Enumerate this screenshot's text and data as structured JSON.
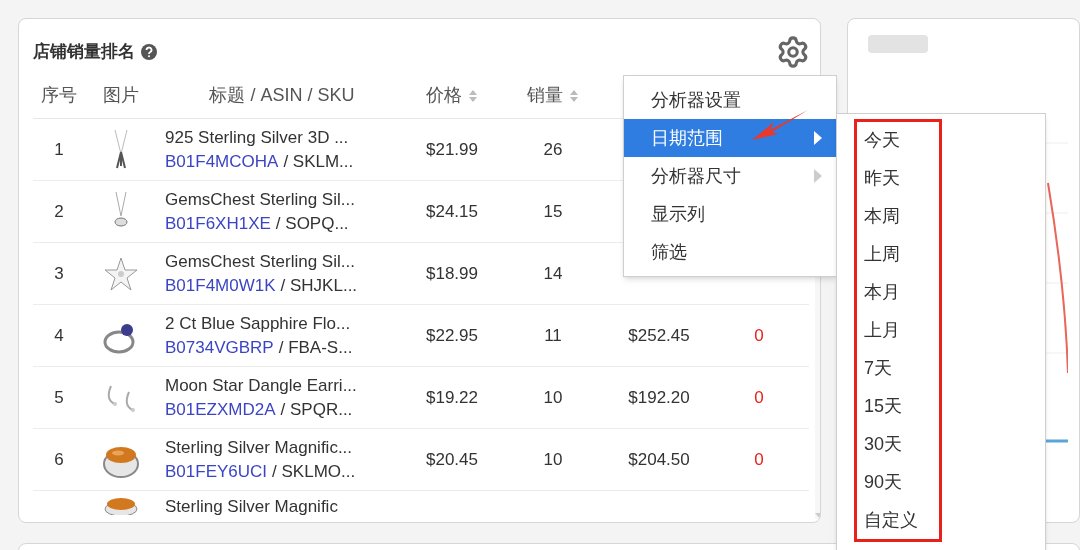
{
  "panel": {
    "title": "店铺销量排名"
  },
  "table": {
    "columns": [
      {
        "label": "序号",
        "sortable": false
      },
      {
        "label": "图片",
        "sortable": false
      },
      {
        "label": "标题 / ASIN / SKU",
        "sortable": false
      },
      {
        "label": "价格",
        "sortable": true
      },
      {
        "label": "销量",
        "sortable": true
      }
    ],
    "rows": [
      {
        "index": "1",
        "title": "925 Sterling Silver 3D ...",
        "asin": "B01F4MCOHA",
        "sku": "/ SKLM...",
        "price": "$21.99",
        "sales": "26"
      },
      {
        "index": "2",
        "title": "GemsChest Sterling Sil...",
        "asin": "B01F6XH1XE",
        "sku": "/ SOPQ...",
        "price": "$24.15",
        "sales": "15"
      },
      {
        "index": "3",
        "title": "GemsChest Sterling Sil...",
        "asin": "B01F4M0W1K",
        "sku": "/ SHJKL...",
        "price": "$18.99",
        "sales": "14"
      },
      {
        "index": "4",
        "title": "2 Ct Blue Sapphire Flo...",
        "asin": "B0734VGBRP",
        "sku": "/ FBA-S...",
        "price": "$22.95",
        "sales": "11",
        "revenue": "$252.45",
        "column_7": "0"
      },
      {
        "index": "5",
        "title": "Moon Star Dangle Earri...",
        "asin": "B01EZXMD2A",
        "sku": "/ SPQR...",
        "price": "$19.22",
        "sales": "10",
        "revenue": "$192.20",
        "column_7": "0"
      },
      {
        "index": "6",
        "title": "Sterling Silver Magnific...",
        "asin": "B01FEY6UCI",
        "sku": "/ SKLMO...",
        "price": "$20.45",
        "sales": "10",
        "revenue": "$204.50",
        "column_7": "0"
      },
      {
        "title": "Sterling Silver Magnific"
      }
    ]
  },
  "menu": {
    "items": [
      {
        "label": "分析器设置",
        "selected": false,
        "submenu": false
      },
      {
        "label": "日期范围",
        "selected": true,
        "submenu": true
      },
      {
        "label": "分析器尺寸",
        "selected": false,
        "submenu": true
      },
      {
        "label": "显示列",
        "selected": false,
        "submenu": false
      },
      {
        "label": "筛选",
        "selected": false,
        "submenu": false
      }
    ]
  },
  "submenu": {
    "items": [
      "今天",
      "昨天",
      "本周",
      "上周",
      "本月",
      "上月",
      "7天",
      "15天",
      "30天",
      "90天",
      "自定义"
    ]
  }
}
